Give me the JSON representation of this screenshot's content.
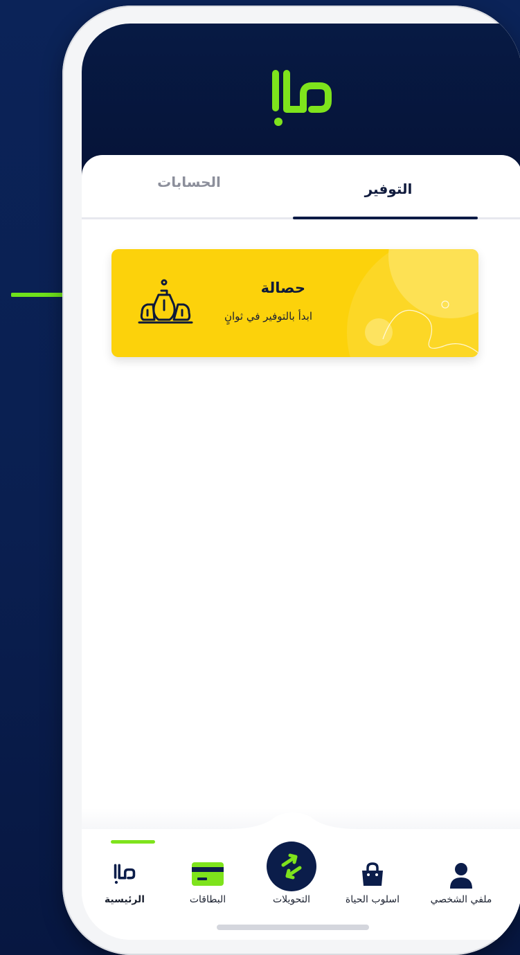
{
  "app": {
    "logo_name": "brand-logo",
    "accent_color": "#7ee31c",
    "card_color": "#fcd20b",
    "header_color": "#061337"
  },
  "tabs": {
    "accounts_label": "الحسابات",
    "saving_label": "التوفير",
    "active": "saving"
  },
  "saving_card": {
    "title": "حصالة",
    "subtitle": "ابدأ بالتوفير في ثوانٍ",
    "icon": "piggy-bank-jars-icon"
  },
  "bottom_nav": {
    "items": [
      {
        "id": "home",
        "label": "الرئيسية",
        "icon": "brand-logo-icon",
        "active": true
      },
      {
        "id": "cards",
        "label": "البطاقات",
        "icon": "card-icon",
        "active": false
      },
      {
        "id": "transfers",
        "label": "التحويلات",
        "icon": "transfer-arrows-icon",
        "active": false
      },
      {
        "id": "lifestyle",
        "label": "اسلوب الحياة",
        "icon": "shopping-bag-icon",
        "active": false
      },
      {
        "id": "profile",
        "label": "ملفي الشخصي",
        "icon": "user-icon",
        "active": false
      }
    ]
  }
}
